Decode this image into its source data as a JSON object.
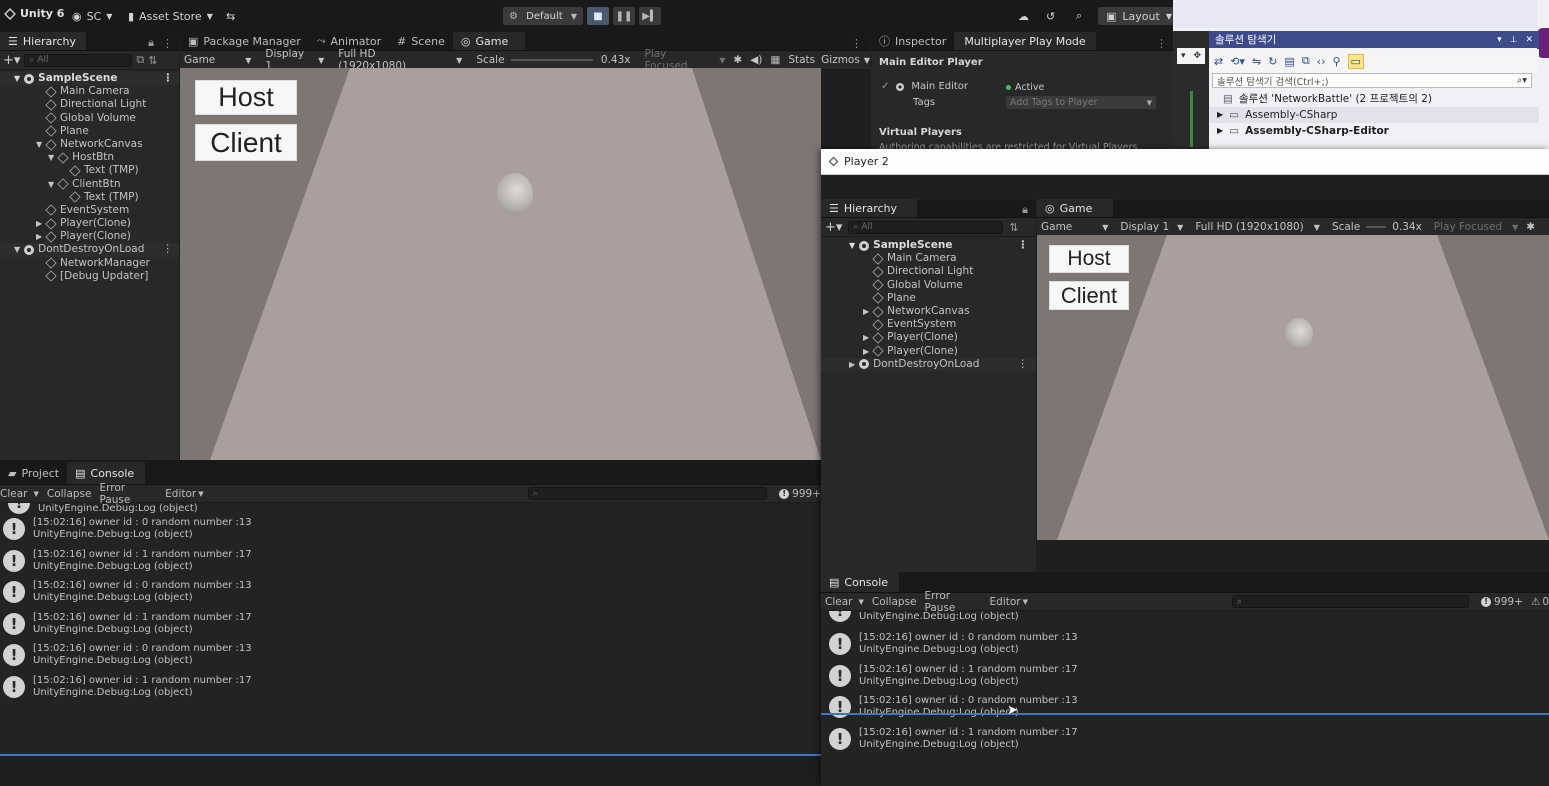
{
  "toolbar": {
    "app": "Unity 6",
    "account": "SC",
    "asset_store": "Asset Store",
    "play_mode_profile": "Default",
    "layout": "Layout"
  },
  "hierarchy": {
    "tab": "Hierarchy",
    "search_placeholder": "All",
    "items": [
      {
        "label": "SampleScene",
        "kind": "scene"
      },
      {
        "label": "Main Camera"
      },
      {
        "label": "Directional Light"
      },
      {
        "label": "Global Volume"
      },
      {
        "label": "Plane"
      },
      {
        "label": "NetworkCanvas"
      },
      {
        "label": "HostBtn"
      },
      {
        "label": "Text (TMP)"
      },
      {
        "label": "ClientBtn"
      },
      {
        "label": "Text (TMP)"
      },
      {
        "label": "EventSystem"
      },
      {
        "label": "Player(Clone)"
      },
      {
        "label": "Player(Clone)"
      },
      {
        "label": "DontDestroyOnLoad",
        "kind": "scene"
      },
      {
        "label": "NetworkManager"
      },
      {
        "label": "[Debug Updater]"
      }
    ]
  },
  "center_tabs": [
    "Package Manager",
    "Animator",
    "Scene",
    "Game"
  ],
  "gamebar": {
    "mode": "Game",
    "display": "Display 1",
    "resolution": "Full HD (1920x1080)",
    "scale_label": "Scale",
    "scale_value": "0.43x",
    "play_focused": "Play Focused",
    "stats": "Stats",
    "gizmos": "Gizmos"
  },
  "game_view": {
    "host_label": "Host",
    "client_label": "Client"
  },
  "inspector": {
    "tabs": [
      "Inspector",
      "Multiplayer Play Mode"
    ],
    "section": "Main Editor Player",
    "player_name": "Main Editor",
    "status": "Active",
    "tags_label": "Tags",
    "tags_placeholder": "Add Tags to Player",
    "virtual_players": "Virtual Players",
    "note": "Authoring capabilities are restricted for Virtual Players"
  },
  "bottom_tabs": [
    "Project",
    "Console"
  ],
  "console": {
    "buttons": {
      "clear": "Clear",
      "collapse": "Collapse",
      "error_pause": "Error Pause",
      "editor": "Editor"
    },
    "count": "999+",
    "partial_top": "UnityEngine.Debug:Log (object)",
    "entries": [
      {
        "msg": "[15:02:16] owner id : 0 random number :13",
        "src": "UnityEngine.Debug:Log (object)"
      },
      {
        "msg": "[15:02:16] owner id : 1 random number :17",
        "src": "UnityEngine.Debug:Log (object)"
      },
      {
        "msg": "[15:02:16] owner id : 0 random number :13",
        "src": "UnityEngine.Debug:Log (object)"
      },
      {
        "msg": "[15:02:16] owner id : 1 random number :17",
        "src": "UnityEngine.Debug:Log (object)"
      },
      {
        "msg": "[15:02:16] owner id : 0 random number :13",
        "src": "UnityEngine.Debug:Log (object)"
      },
      {
        "msg": "[15:02:16] owner id : 1 random number :17",
        "src": "UnityEngine.Debug:Log (object)"
      }
    ]
  },
  "solution_explorer": {
    "title": "솔루션 탐색기",
    "search_placeholder": "솔루션 탐색기 검색(Ctrl+;)",
    "solution": "솔루션 'NetworkBattle' (2 프로젝트의 2)",
    "projects": [
      "Assembly-CSharp",
      "Assembly-CSharp-Editor"
    ]
  },
  "player2": {
    "title": "Player 2",
    "hierarchy_tab": "Hierarchy",
    "game_tab": "Game",
    "search_placeholder": "All",
    "items": [
      {
        "label": "SampleScene",
        "kind": "scene"
      },
      {
        "label": "Main Camera"
      },
      {
        "label": "Directional Light"
      },
      {
        "label": "Global Volume"
      },
      {
        "label": "Plane"
      },
      {
        "label": "NetworkCanvas"
      },
      {
        "label": "EventSystem"
      },
      {
        "label": "Player(Clone)"
      },
      {
        "label": "Player(Clone)"
      },
      {
        "label": "DontDestroyOnLoad",
        "kind": "scene"
      }
    ],
    "gamebar": {
      "mode": "Game",
      "display": "Display 1",
      "resolution": "Full HD (1920x1080)",
      "scale_label": "Scale",
      "scale_value": "0.34x",
      "play_focused": "Play Focused"
    },
    "host_label": "Host",
    "client_label": "Client",
    "console_tab": "Console",
    "console_buttons": {
      "clear": "Clear",
      "collapse": "Collapse",
      "error_pause": "Error Pause",
      "editor": "Editor"
    },
    "console_count": "999+",
    "console_err": "0",
    "partial_top": "UnityEngine.Debug:Log (object)",
    "entries": [
      {
        "msg": "[15:02:16] owner id : 0 random number :13",
        "src": "UnityEngine.Debug:Log (object)"
      },
      {
        "msg": "[15:02:16] owner id : 1 random number :17",
        "src": "UnityEngine.Debug:Log (object)"
      },
      {
        "msg": "[15:02:16] owner id : 0 random number :13",
        "src": "UnityEngine.Debug:Log (object)"
      },
      {
        "msg": "[15:02:16] owner id : 1 random number :17",
        "src": "UnityEngine.Debug:Log (object)"
      }
    ]
  }
}
